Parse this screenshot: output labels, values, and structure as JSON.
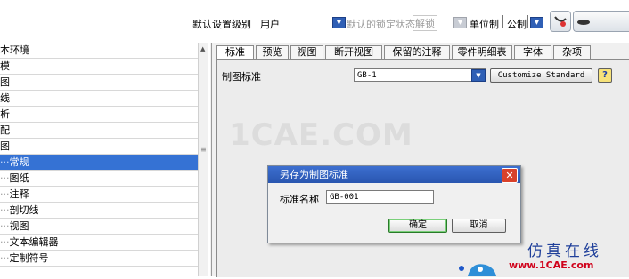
{
  "toolbar": {
    "default_level_label": "默认设置级别",
    "level_value": "用户",
    "lock_label": "默认的锁定状态",
    "lock_value": "解锁",
    "unit_label": "单位制",
    "unit_value": "公制"
  },
  "tree": {
    "items": [
      {
        "label": "本环境",
        "dots": ""
      },
      {
        "label": "模",
        "dots": ""
      },
      {
        "label": "图",
        "dots": ""
      },
      {
        "label": "线",
        "dots": ""
      },
      {
        "label": "析",
        "dots": ""
      },
      {
        "label": "配",
        "dots": ""
      },
      {
        "label": "图",
        "dots": ""
      },
      {
        "label": "常规",
        "dots": "···"
      },
      {
        "label": "图纸",
        "dots": "···"
      },
      {
        "label": "注释",
        "dots": "···"
      },
      {
        "label": "剖切线",
        "dots": "···"
      },
      {
        "label": "视图",
        "dots": "···"
      },
      {
        "label": "文本编辑器",
        "dots": "···"
      },
      {
        "label": "定制符号",
        "dots": "···"
      }
    ]
  },
  "tabs": [
    "标准",
    "预览",
    "视图",
    "断开视图",
    "保留的注释",
    "零件明细表",
    "字体",
    "杂项"
  ],
  "content": {
    "standard_label": "制图标准",
    "standard_value": "GB-1",
    "customize_button": "Customize Standard",
    "help_icon": "?"
  },
  "watermark": "1CAE.COM",
  "dialog": {
    "title": "另存为制图标准",
    "name_label": "标准名称",
    "name_value": "GB-001",
    "ok": "确定",
    "cancel": "取消"
  },
  "brand": {
    "title": "仿真在线",
    "url": "www.1CAE.com"
  }
}
